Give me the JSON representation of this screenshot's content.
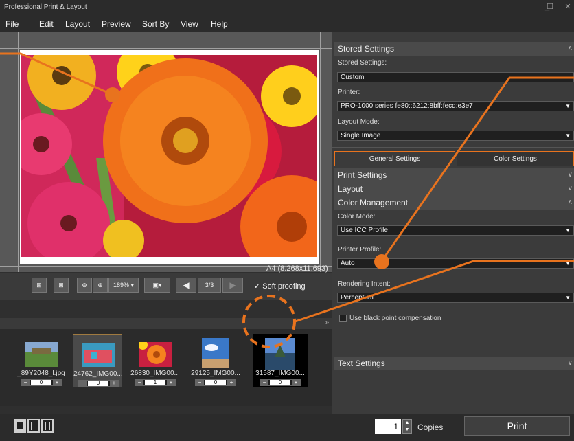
{
  "window": {
    "title": "Professional Print & Layout",
    "min": "_",
    "max": "☐",
    "close": "✕"
  },
  "menu": {
    "items": [
      "File",
      "Edit",
      "Layout",
      "Preview",
      "Sort By",
      "View",
      "Help"
    ]
  },
  "preview": {
    "paper_size": "A4 (8.268x11.693)"
  },
  "toolbar": {
    "zoom": "189%",
    "page": "3/3",
    "soft_proofing": "Soft proofing",
    "soft_proofing_checked": true
  },
  "thumbnails": [
    {
      "label": "_89Y2048_l.jpg",
      "count": "0",
      "selected": false
    },
    {
      "label": "24762_IMG00...",
      "count": "0",
      "selected": true
    },
    {
      "label": "26830_IMG00...",
      "count": "1",
      "selected": false
    },
    {
      "label": "29125_IMG00...",
      "count": "0",
      "selected": false
    },
    {
      "label": "31587_IMG00...",
      "count": "0",
      "selected": false
    }
  ],
  "bottom": {
    "copies_value": "1",
    "copies_label": "Copies",
    "print_label": "Print"
  },
  "panel": {
    "stored_settings_head": "Stored Settings",
    "stored_settings_label": "Stored Settings:",
    "stored_settings_value": "Custom",
    "printer_label": "Printer:",
    "printer_value": "PRO-1000 series fe80::6212:8bff:fecd:e3e7",
    "layout_mode_label": "Layout Mode:",
    "layout_mode_value": "Single Image",
    "tab_general": "General Settings",
    "tab_color": "Color Settings",
    "print_settings_head": "Print Settings",
    "layout_head": "Layout",
    "color_management_head": "Color Management",
    "color_mode_label": "Color Mode:",
    "color_mode_value": "Use ICC Profile",
    "printer_profile_label": "Printer Profile:",
    "printer_profile_value": "Auto",
    "rendering_intent_label": "Rendering Intent:",
    "rendering_intent_value": "Perceptual",
    "black_point_label": "Use black point compensation",
    "text_settings_head": "Text Settings"
  },
  "colors": {
    "accent": "#e8731e",
    "background": "#2f2f2f",
    "panel": "#3b3b3b",
    "section_head": "#4a4a4a"
  }
}
